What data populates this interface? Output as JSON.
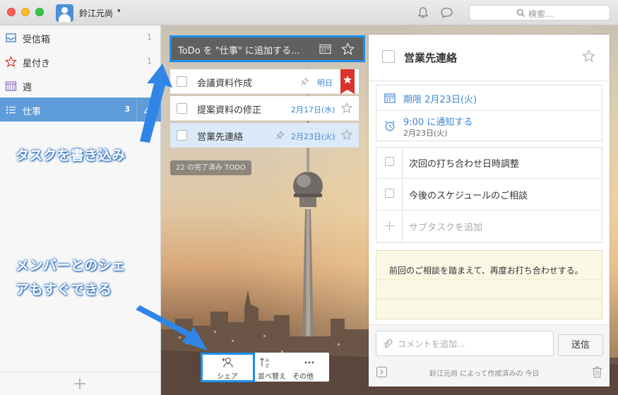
{
  "window": {
    "user_name": "鈴江元尚",
    "search_placeholder": "検索..."
  },
  "sidebar": {
    "items": [
      {
        "label": "受信箱",
        "count": "1",
        "icon": "inbox-icon"
      },
      {
        "label": "星付き",
        "count": "1",
        "icon": "star-icon"
      },
      {
        "label": "週",
        "count": "",
        "icon": "calendar-week-icon"
      },
      {
        "label": "仕事",
        "count": "3",
        "icon": "list-icon",
        "active": true
      }
    ]
  },
  "add_todo": {
    "placeholder": "ToDo を \"仕事\" に追加する..."
  },
  "tasks": [
    {
      "title": "会議資料作成",
      "due": "明日",
      "pinned": true,
      "starred": true
    },
    {
      "title": "提案資料の修正",
      "due": "2月17日(水)",
      "pinned": false,
      "starred": false
    },
    {
      "title": "営業先連絡",
      "due": "2月23日(火)",
      "pinned": true,
      "starred": false,
      "selected": true
    }
  ],
  "completed_label": "22 の完了済み TODO",
  "toolbar": {
    "share": "シェア",
    "sort": "並べ替え",
    "more": "その他"
  },
  "annotations": {
    "write_task": "タスクを書き込み",
    "share_line1": "メンバーとのシェ",
    "share_line2": "アもすぐできる"
  },
  "detail": {
    "title": "営業先連絡",
    "due_date": "期限 2月23日(火)",
    "reminder": "9:00 に通知する",
    "reminder_date": "2月23日(火)",
    "subtasks": [
      "次回の打ち合わせ日時調整",
      "今後のスケジュールのご相談"
    ],
    "add_subtask_placeholder": "サブタスクを追加",
    "note": "前回のご相談を踏まえて、再度お打ち合わせする。",
    "comment_placeholder": "コメントを追加...",
    "send_label": "送信",
    "created_by": "鈴江元尚 によって作成済みの 今日"
  },
  "colors": {
    "accent": "#5f9cda",
    "highlight_border": "#1e8fee",
    "due_text": "#3d86d4",
    "ribbon": "#d9342b"
  }
}
